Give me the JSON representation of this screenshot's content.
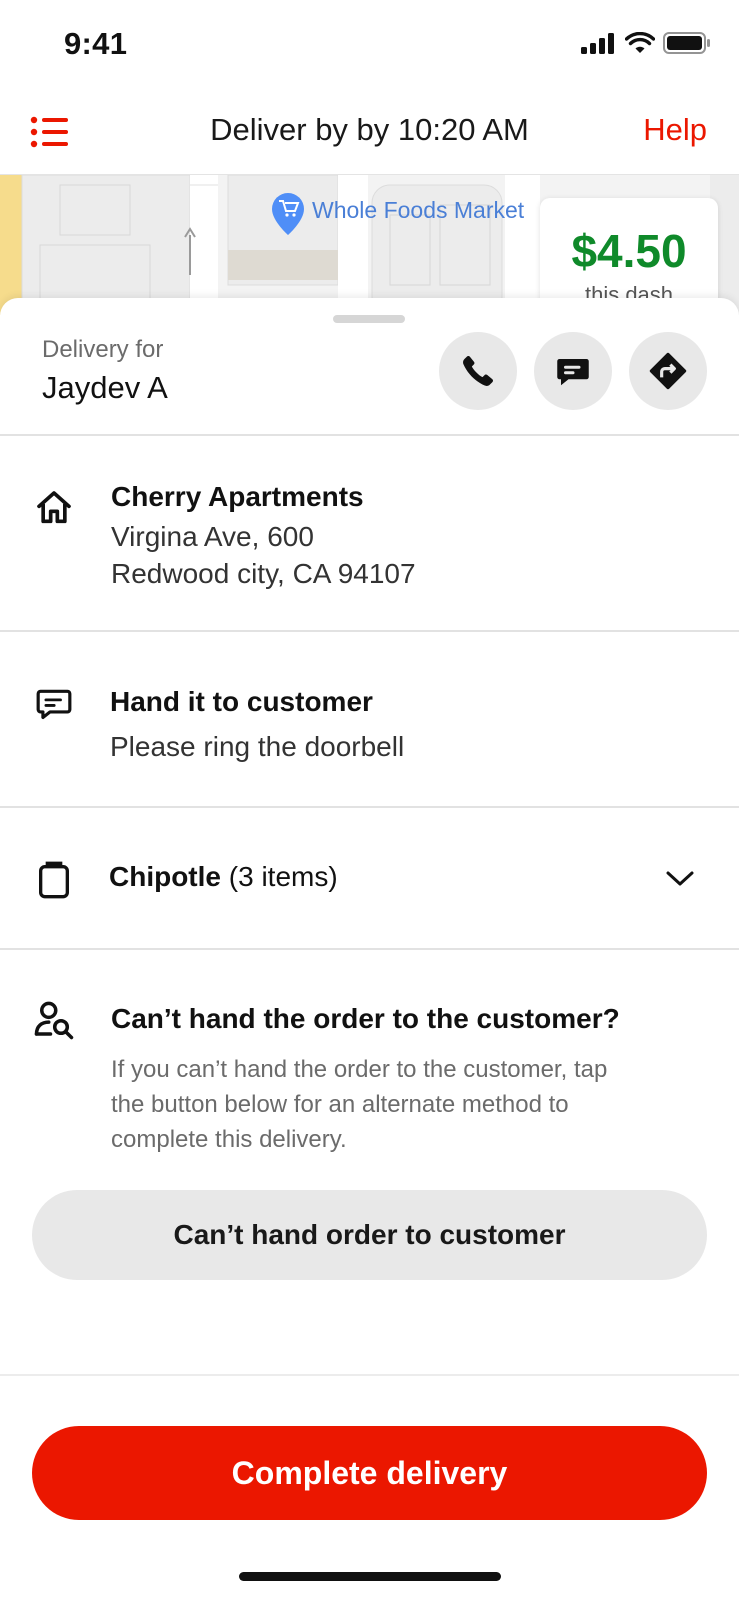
{
  "status_bar": {
    "time": "9:41",
    "signal_icon": "cellular-signal-icon",
    "wifi_icon": "wifi-icon",
    "battery_icon": "battery-icon"
  },
  "header": {
    "title": "Deliver by by 10:20 AM",
    "help_label": "Help",
    "menu_icon": "list-menu-icon",
    "accent_color": "#eb1700"
  },
  "map": {
    "place_label": "Whole Foods Market",
    "pin_icon": "shopping-cart-pin-icon"
  },
  "earnings": {
    "amount": "$4.50",
    "caption": "this dash",
    "color": "#0f8a2a"
  },
  "delivery": {
    "label": "Delivery for",
    "customer_name": "Jaydev A",
    "actions": [
      "phone-icon",
      "chat-icon",
      "directions-icon"
    ]
  },
  "address": {
    "name": "Cherry Apartments",
    "line1": "Virgina Ave, 600",
    "line2": "Redwood city, CA 94107",
    "icon": "home-icon"
  },
  "instructions": {
    "title": "Hand it to customer",
    "note": "Please ring the doorbell",
    "icon": "message-icon"
  },
  "order": {
    "store": "Chipotle",
    "count": "(3 items)",
    "icon": "bag-icon",
    "expand_icon": "chevron-down-icon"
  },
  "cant_hand": {
    "title": "Can’t hand the order to the customer?",
    "line1": "If you can’t hand the order to the customer, tap",
    "line2": "the button below for an alternate method to",
    "line3": "complete this delivery.",
    "button_label": "Can’t hand order to customer",
    "icon": "user-search-icon"
  },
  "footer": {
    "complete_label": "Complete delivery",
    "button_color": "#eb1700"
  }
}
